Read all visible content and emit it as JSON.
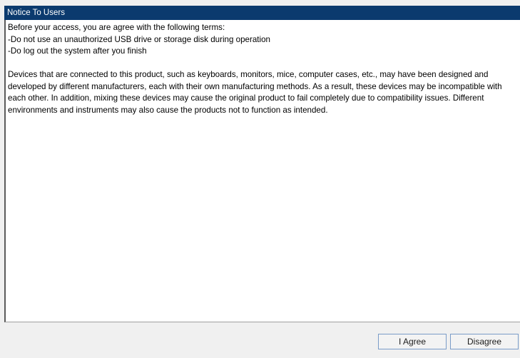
{
  "dialog": {
    "title": "Notice To Users",
    "intro": "Before your access, you are agree with the following terms:",
    "terms": [
      "-Do not use an unauthorized USB drive or storage disk during operation",
      "-Do log out the system after you finish"
    ],
    "body_lines": [
      "Devices that are connected to this product, such as keyboards, monitors, mice, computer cases, etc., may have been designed and",
      "developed by different manufacturers, each with their own manufacturing methods. As a result, these devices may be incompatible with",
      "each other. In addition, mixing these devices may cause the original product to fail completely due to compatibility issues. Different",
      "environments and instruments may also cause the products not to function as intended."
    ]
  },
  "buttons": {
    "agree_label": "I Agree",
    "disagree_label": "Disagree"
  },
  "colors": {
    "title_bar": "#0b3a6e",
    "title_text": "#ffffff",
    "content_bg": "#ffffff",
    "footer_bg": "#f0f0f0",
    "button_border": "#7a9cc8"
  }
}
